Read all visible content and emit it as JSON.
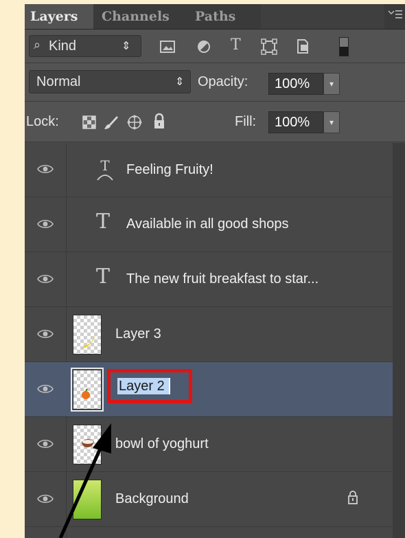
{
  "tabs": [
    "Layers",
    "Channels",
    "Paths"
  ],
  "filter": {
    "label": "Kind",
    "search_glyph": "⌕",
    "arrows": "⇕"
  },
  "blend": {
    "mode": "Normal",
    "opacity_label": "Opacity:",
    "opacity_value": "100%"
  },
  "lock": {
    "label": "Lock:",
    "fill_label": "Fill:",
    "fill_value": "100%"
  },
  "layers": [
    {
      "name": "Feeling Fruity!",
      "kind": "warped-text"
    },
    {
      "name": "Available in all good shops",
      "kind": "text"
    },
    {
      "name": "The new fruit breakfast to star...",
      "kind": "text"
    },
    {
      "name": "Layer 3",
      "kind": "pixel"
    },
    {
      "name": "Layer 2",
      "kind": "pixel",
      "selected": true,
      "renaming": true
    },
    {
      "name": "bowl of yoghurt",
      "kind": "pixel"
    },
    {
      "name": "Background",
      "kind": "background",
      "locked": true
    }
  ],
  "type_glyph": "T",
  "colors": {
    "highlight": "#e01414",
    "selection": "#4e5a70",
    "panel": "#535353"
  }
}
